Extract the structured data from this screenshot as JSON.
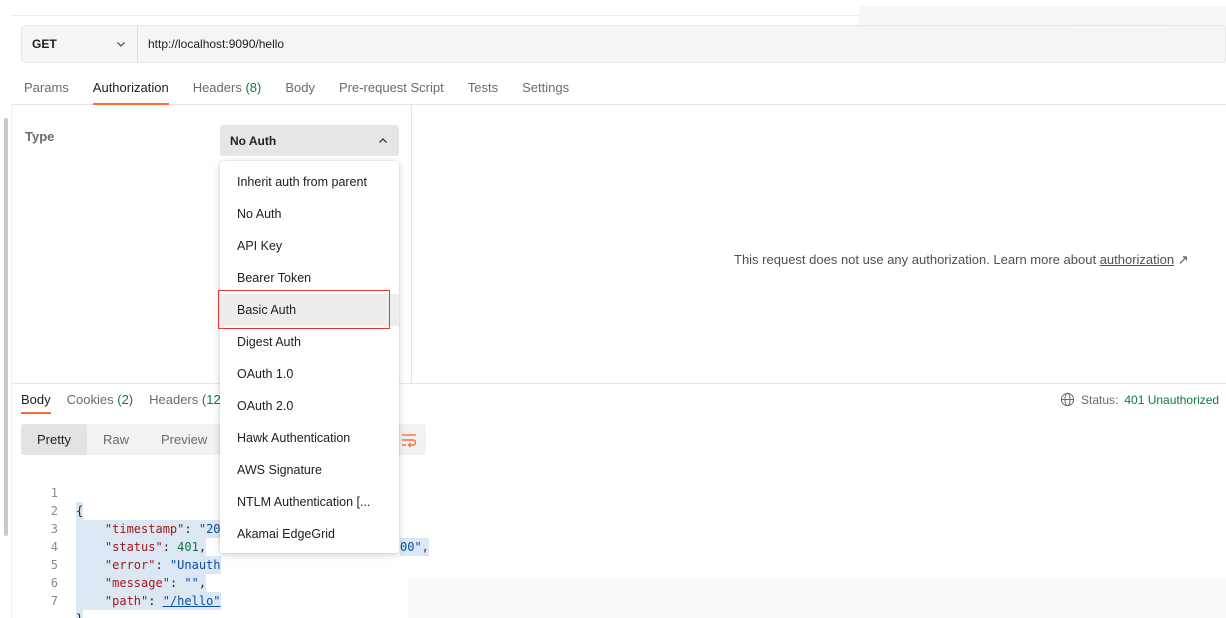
{
  "request": {
    "method": "GET",
    "url": "http://localhost:9090/hello"
  },
  "header": {
    "blurred_text": "· ·  · ·  · · ·  · · · ·"
  },
  "request_tabs": [
    {
      "label": "Params",
      "count": ""
    },
    {
      "label": "Authorization",
      "count": "",
      "active": true
    },
    {
      "label": "Headers",
      "count": "(8)"
    },
    {
      "label": "Body",
      "count": ""
    },
    {
      "label": "Pre-request Script",
      "count": ""
    },
    {
      "label": "Tests",
      "count": ""
    },
    {
      "label": "Settings",
      "count": ""
    }
  ],
  "auth": {
    "type_label": "Type",
    "selected": "No Auth",
    "message": "This request does not use any authorization. Learn more about",
    "link_text": "authorization",
    "link_arrow": "↗",
    "options": [
      "Inherit auth from parent",
      "No Auth",
      "API Key",
      "Bearer Token",
      "Basic Auth",
      "Digest Auth",
      "OAuth 1.0",
      "OAuth 2.0",
      "Hawk Authentication",
      "AWS Signature",
      "NTLM Authentication [...",
      "Akamai EdgeGrid"
    ],
    "hovered_option": "Basic Auth"
  },
  "response_tabs": [
    {
      "label": "Body",
      "count": "",
      "active": true
    },
    {
      "label": "Cookies",
      "count": "(2)"
    },
    {
      "label": "Headers",
      "count": "(12)"
    }
  ],
  "status": {
    "label": "Status:",
    "value": "401 Unauthorized"
  },
  "view_modes": [
    "Pretty",
    "Raw",
    "Preview"
  ],
  "active_view": "Pretty",
  "code": {
    "lines": [
      "1",
      "2",
      "3",
      "4",
      "5",
      "6",
      "7"
    ],
    "open_brace": "{",
    "close_brace": "}",
    "timestamp_key": "\"timestamp\"",
    "timestamp_val": "\"20",
    "timestamp_tail": "00\",",
    "status_key": "\"status\"",
    "status_val": "401",
    "error_key": "\"error\"",
    "error_val": "\"Unauth",
    "message_key": "\"message\"",
    "message_val": "\"\"",
    "path_key": "\"path\"",
    "path_val": "\"/hello\""
  },
  "colors": {
    "accent": "#ff6c37",
    "success": "#0f7b3e",
    "highlight_border": "#e03a3a"
  }
}
